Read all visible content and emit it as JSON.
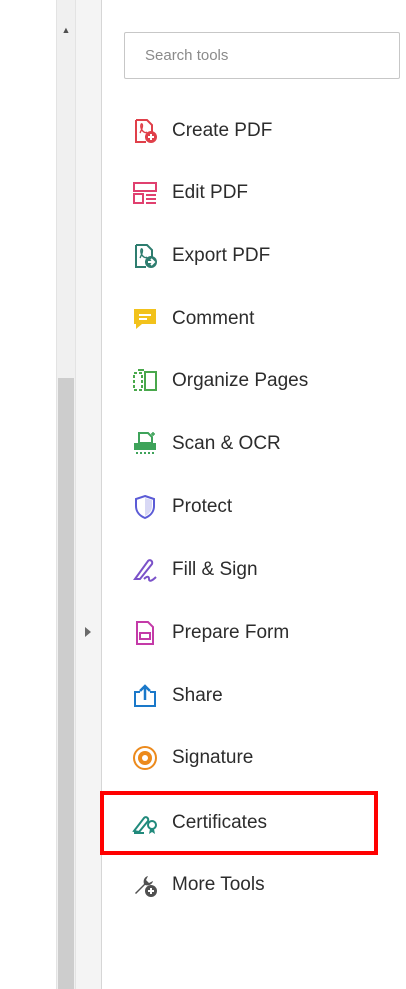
{
  "search": {
    "placeholder": "Search tools"
  },
  "tools": [
    {
      "label": "Create PDF",
      "icon": "create-pdf-icon"
    },
    {
      "label": "Edit PDF",
      "icon": "edit-pdf-icon"
    },
    {
      "label": "Export PDF",
      "icon": "export-pdf-icon"
    },
    {
      "label": "Comment",
      "icon": "comment-icon"
    },
    {
      "label": "Organize Pages",
      "icon": "organize-pages-icon"
    },
    {
      "label": "Scan & OCR",
      "icon": "scan-ocr-icon"
    },
    {
      "label": "Protect",
      "icon": "shield-icon"
    },
    {
      "label": "Fill & Sign",
      "icon": "pen-sign-icon"
    },
    {
      "label": "Prepare Form",
      "icon": "form-icon"
    },
    {
      "label": "Share",
      "icon": "share-upload-icon"
    },
    {
      "label": "Signature",
      "icon": "signature-badge-icon"
    },
    {
      "label": "Certificates",
      "icon": "certificate-pen-icon",
      "highlighted": true
    },
    {
      "label": "More Tools",
      "icon": "wrench-plus-icon"
    }
  ],
  "colors": {
    "highlight": "#ff0000",
    "create_pdf": "#e0404a",
    "edit_pdf": "#e0406f",
    "export_pdf": "#2e7d6f",
    "comment": "#f2c21b",
    "organize": "#49a84c",
    "scan": "#3ea35a",
    "protect": "#5b5bd6",
    "fill_sign": "#7b52c9",
    "prepare_form": "#c43aa8",
    "share": "#1a78c9",
    "signature": "#ec8a1c",
    "certificates": "#218a7c",
    "more_tools": "#505050"
  }
}
